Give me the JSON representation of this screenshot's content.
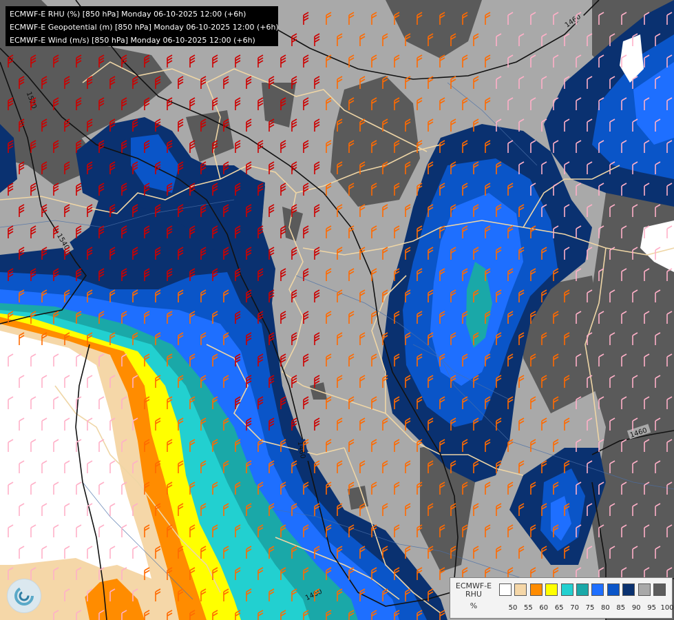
{
  "header": {
    "lines": [
      "ECMWF-E RHU (%) [850 hPa] Monday 06-10-2025 12:00 (+6h)",
      "ECMWF-E Geopotential (m) [850 hPa] Monday 06-10-2025 12:00 (+6h)",
      "ECMWF-E Wind (m/s) [850 hPa] Monday 06-10-2025 12:00 (+6h)"
    ]
  },
  "contours": {
    "labels": [
      "1460",
      "1520",
      "1540",
      "1460",
      "1460",
      "1460"
    ]
  },
  "legend": {
    "title_line1": "ECMWF-E",
    "title_line2": "RHU",
    "unit": "%",
    "ticks": [
      "50",
      "55",
      "60",
      "65",
      "70",
      "75",
      "80",
      "85",
      "90",
      "95",
      "100"
    ],
    "colors": [
      "#ffffff",
      "#f5d7a8",
      "#ff8c00",
      "#ffff00",
      "#22d0d0",
      "#1aa8a8",
      "#1e6fff",
      "#0a55c8",
      "#0a3170",
      "#a9a9a9",
      "#5c5c5c"
    ]
  },
  "map_colors": {
    "humid_dark": "#5a5a5a",
    "humid_grey": "#a9a9a9",
    "navy": "#0a3170",
    "blue": "#0a55c8",
    "light_blue": "#1e6fff",
    "teal": "#1aa8a8",
    "cyan": "#22d0d0",
    "yellow": "#ffff00",
    "orange": "#ff8c00",
    "tan": "#f5d7a8",
    "dry": "#ffffff",
    "border": "#efd6a6",
    "river": "#4a6fa8",
    "wind_strong": "#cc0000",
    "wind_mid": "#ff6a00",
    "wind_weak": "#ffb0c8"
  }
}
